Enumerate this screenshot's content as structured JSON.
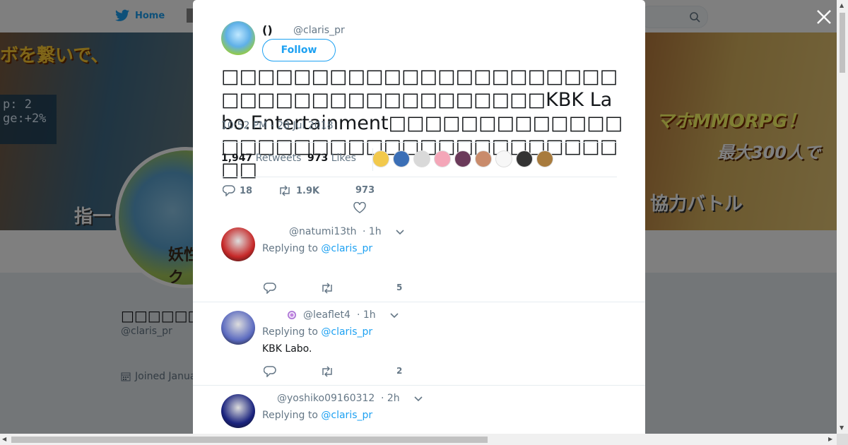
{
  "background": {
    "nav": {
      "home_label": "Home"
    },
    "banner": {
      "left_text": "ボを繋いで、",
      "left_bottom_text": "指一",
      "hud_text": "p: 2\nge:+2%",
      "right_text_1": "マホMMORPG！",
      "right_text_2": "最大300人で",
      "right_text_3": "協力バトル"
    },
    "avatar_text": "妖性\nク",
    "profile": {
      "name": "□□□□□□□□□",
      "handle": "@claris_pr",
      "joined": "Joined Janua"
    }
  },
  "modal": {
    "author": {
      "name": "()",
      "handle": "@claris_pr"
    },
    "follow_label": "Follow",
    "tweet_text": "□□□□□□□□□□□□□□□□□□□□□□□□□□□□□□□□□□□□□□□□KBK Labo.Entertainment□□□□□□□□□□□□□□□□□□□□□□□□□□□□□□□□□□□□□",
    "timestamp": "10:52 PM - 28 Jul 2018",
    "stats": {
      "retweets_count": "1,947",
      "retweets_label": "Retweets",
      "likes_count": "973",
      "likes_label": "Likes"
    },
    "liker_colors": [
      "#f2c94c",
      "#3b6fb6",
      "#d9d9d9",
      "#f4a6b8",
      "#6b3a5a",
      "#c98b6b",
      "#f7f7f7",
      "#333333",
      "#a87b3d"
    ],
    "actions": {
      "replies": "18",
      "retweets": "1.9K",
      "likes": "973"
    },
    "replies": [
      {
        "handle": "@natumi13th",
        "time": "· 1h",
        "replying_prefix": "Replying to ",
        "replying_to": "@claris_pr",
        "text": "",
        "reply_count": "",
        "retweet_count": "",
        "like_count": "5",
        "avatar_color": "#c62828"
      },
      {
        "handle": "@leaflet4",
        "time": "· 1h",
        "replying_prefix": "Replying to ",
        "replying_to": "@claris_pr",
        "text": "KBK Labo.",
        "reply_count": "",
        "retweet_count": "",
        "like_count": "2",
        "avatar_color": "#5c6bc0"
      },
      {
        "handle": "@yoshiko09160312",
        "time": "· 2h",
        "replying_prefix": "Replying to ",
        "replying_to": "@claris_pr",
        "text": "",
        "reply_count": "",
        "retweet_count": "",
        "like_count": "",
        "avatar_color": "#1a237e"
      }
    ]
  }
}
